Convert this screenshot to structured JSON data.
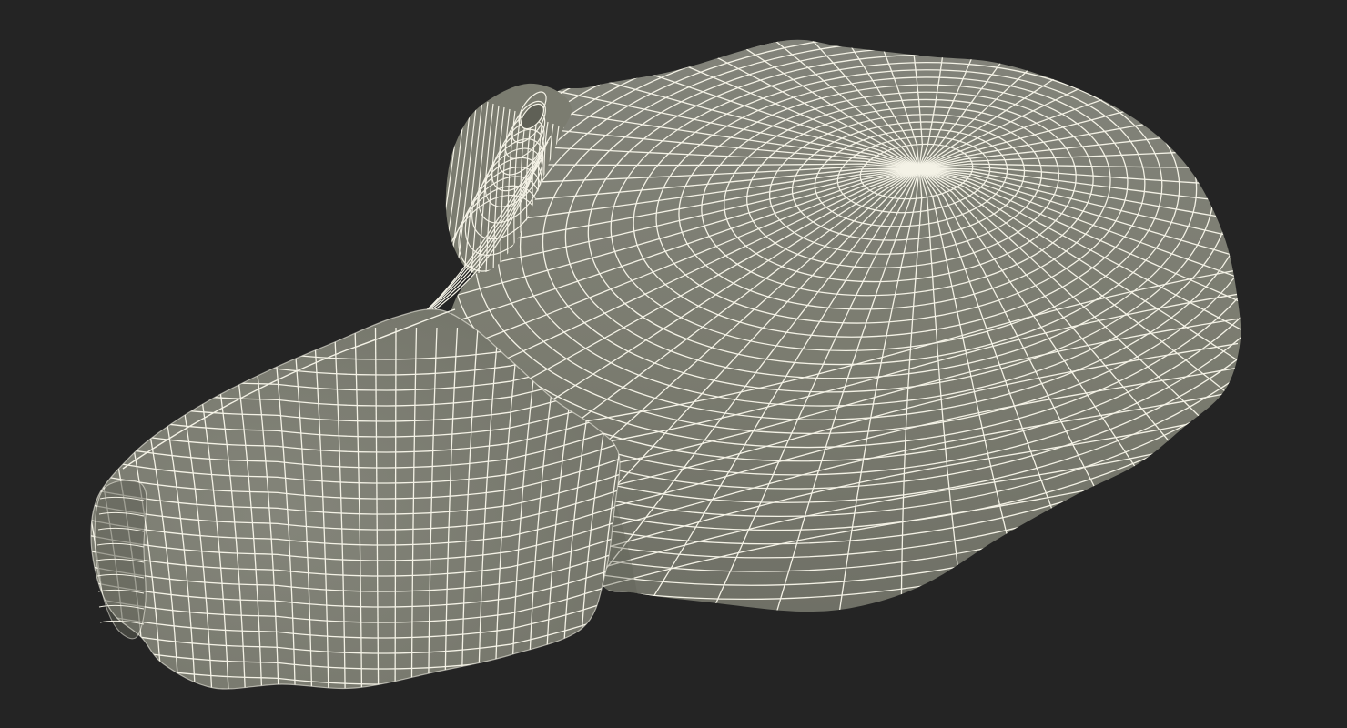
{
  "scene": {
    "subject": "wireframe-mesh-render",
    "background_color": "#242424",
    "surface_color": "#7b7c70",
    "surface_shadow_color": "#5f6056",
    "surface_highlight_color": "#8b8c80",
    "wire_color": "#f4f2e6",
    "parts": [
      {
        "id": "main-body"
      },
      {
        "id": "front-lobe"
      },
      {
        "id": "top-loop"
      }
    ]
  }
}
